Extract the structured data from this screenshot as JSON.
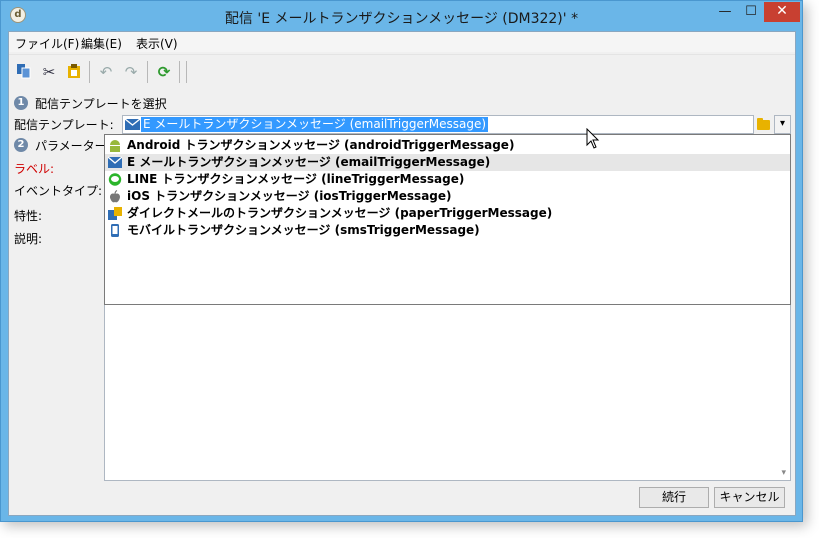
{
  "window": {
    "title": "配信 'E メールトランザクションメッセージ (DM322)' *",
    "app_icon_glyph": "d",
    "minimize_glyph": "—",
    "maximize_glyph": "☐",
    "close_glyph": "✕"
  },
  "menubar": {
    "items": [
      {
        "label": "ファイル(F)"
      },
      {
        "label": "編集(E)"
      },
      {
        "label": "表示(V)"
      }
    ]
  },
  "toolbar": {
    "icons": [
      "copy-icon",
      "cut-icon",
      "paste-icon",
      "undo-icon",
      "redo-icon",
      "refresh-icon"
    ],
    "glyphs": {
      "cut": "✂",
      "undo": "↶",
      "redo": "↷",
      "refresh": "⟳"
    }
  },
  "steps": {
    "step1": {
      "number": "1",
      "label": "配信テンプレートを選択"
    },
    "step2": {
      "number": "2",
      "label": "パラメーターを入"
    }
  },
  "form": {
    "template_label": "配信テンプレート:",
    "label_label": "ラベル:",
    "event_type_label": "イベントタイプ:",
    "property_label": "特性:",
    "description_label": "説明:"
  },
  "combo": {
    "selected_value": "E メールトランザクションメッセージ (emailTriggerMessage)",
    "arrow_glyph": "▾"
  },
  "dropdown": {
    "items": [
      {
        "label": "Android トランザクションメッセージ (androidTriggerMessage)",
        "icon": "android-icon"
      },
      {
        "label": "E メールトランザクションメッセージ (emailTriggerMessage)",
        "icon": "email-icon",
        "hover": true
      },
      {
        "label": "LINE トランザクションメッセージ (lineTriggerMessage)",
        "icon": "line-icon"
      },
      {
        "label": "iOS トランザクションメッセージ (iosTriggerMessage)",
        "icon": "apple-icon"
      },
      {
        "label": "ダイレクトメールのトランザクションメッセージ (paperTriggerMessage)",
        "icon": "direct-mail-icon"
      },
      {
        "label": "モバイルトランザクションメッセージ (smsTriggerMessage)",
        "icon": "mobile-icon"
      }
    ]
  },
  "panel": {
    "scroll_down_glyph": "▾"
  },
  "buttons": {
    "continue_label": "続行",
    "cancel_label": "キャンセル"
  },
  "colors": {
    "title_bar": "#6ab6e8",
    "selection": "#3399ff",
    "close_button": "#c84031",
    "step_badge": "#6f89a8",
    "required_label": "#d00000"
  }
}
